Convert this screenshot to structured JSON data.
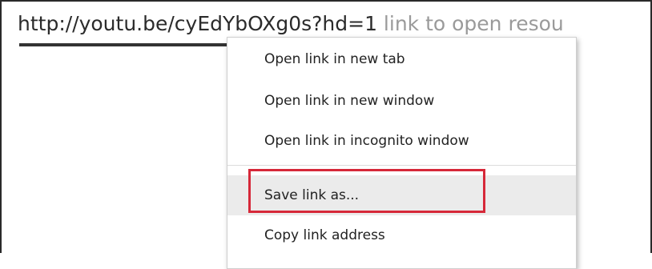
{
  "document": {
    "link_url": "http://youtu.be/cyEdYbOXg0s?hd=1",
    "link_description": " link to open resou"
  },
  "context_menu": {
    "items": [
      {
        "label": "Open link in new tab"
      },
      {
        "label": "Open link in new window"
      },
      {
        "label": "Open link in incognito window"
      },
      {
        "label": "Save link as...",
        "highlighted": true
      },
      {
        "label": "Copy link address"
      }
    ]
  },
  "annotation": {
    "highlight_color": "#d62839",
    "target": "Save link as..."
  }
}
